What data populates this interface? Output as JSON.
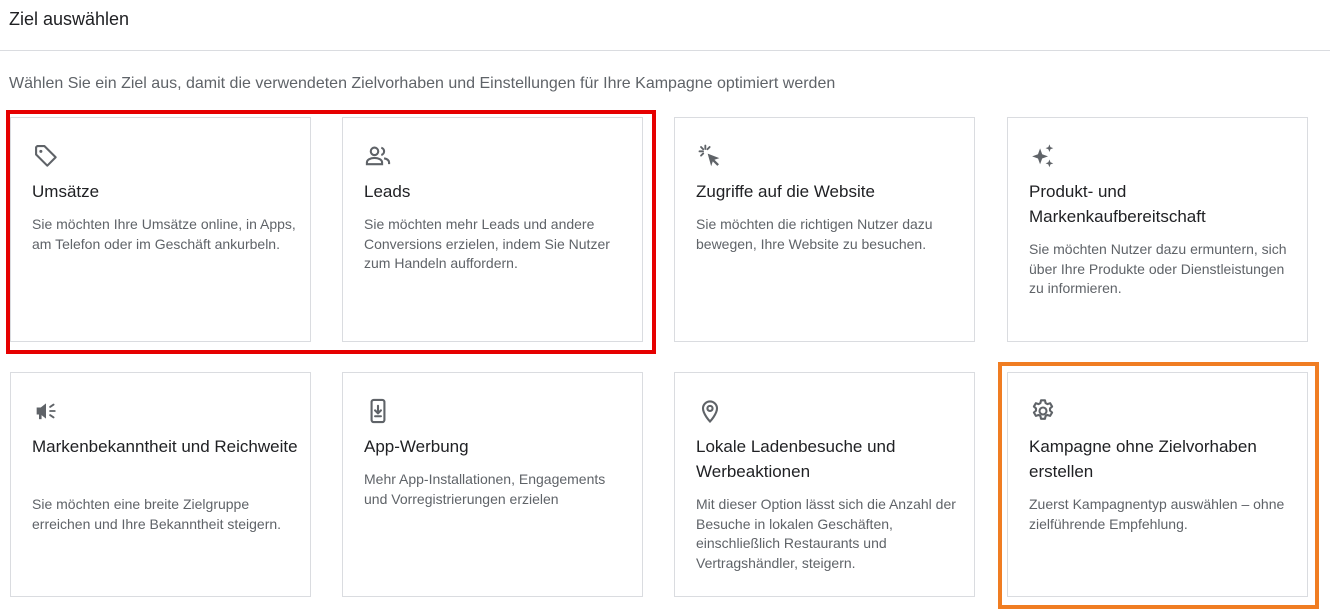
{
  "header": {
    "title": "Ziel auswählen"
  },
  "subtitle": "Wählen Sie ein Ziel aus, damit die verwendeten Zielvorhaben und Einstellungen für Ihre Kampagne optimiert werden",
  "colors": {
    "highlight_red": "#e60000",
    "highlight_orange": "#f07d22",
    "icon": "#5f6368"
  },
  "cards": [
    {
      "icon": "tag-icon",
      "title": "Umsätze",
      "description": "Sie möchten Ihre Umsätze online, in Apps, am Telefon oder im Geschäft ankurbeln."
    },
    {
      "icon": "people-icon",
      "title": "Leads",
      "description": "Sie möchten mehr Leads und andere Conversions erzielen, indem Sie Nutzer zum Handeln auffordern."
    },
    {
      "icon": "cursor-click-icon",
      "title": "Zugriffe auf die Website",
      "description": "Sie möchten die richtigen Nutzer dazu bewegen, Ihre Website zu besuchen."
    },
    {
      "icon": "sparkle-icon",
      "title": "Produkt- und Markenkaufbereitschaft",
      "description": "Sie möchten Nutzer dazu ermuntern, sich über Ihre Produkte oder Dienstleistungen zu informieren."
    },
    {
      "icon": "megaphone-icon",
      "title": "Markenbekanntheit und Reichweite",
      "description": "Sie möchten eine breite Zielgruppe erreichen und Ihre Bekanntheit steigern."
    },
    {
      "icon": "phone-download-icon",
      "title": "App-Werbung",
      "description": "Mehr App-Installationen, Engagements und Vorregistrierungen erzielen"
    },
    {
      "icon": "location-pin-icon",
      "title": "Lokale Ladenbesuche und Werbeaktionen",
      "description": "Mit dieser Option lässt sich die Anzahl der Besuche in lokalen Geschäften, einschließlich Restaurants und Vertragshändler, steigern."
    },
    {
      "icon": "gear-icon",
      "title": "Kampagne ohne Zielvorhaben erstellen",
      "description": "Zuerst Kampagnentyp auswählen – ohne zielführende Empfehlung."
    }
  ]
}
